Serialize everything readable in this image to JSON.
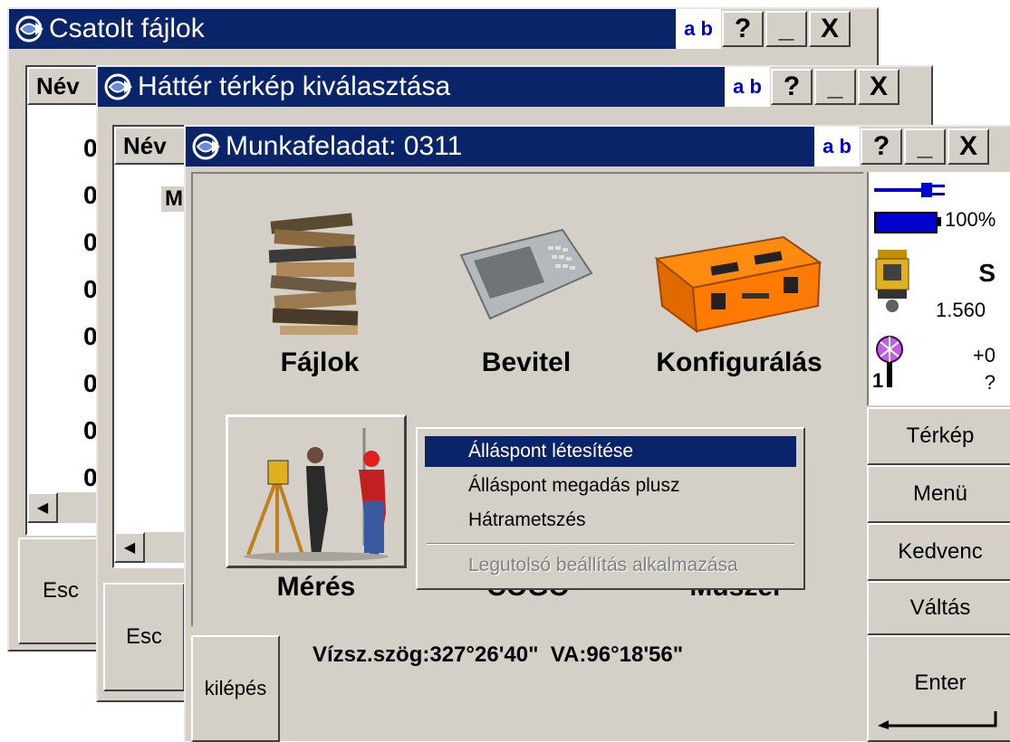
{
  "windows": {
    "csatolt": {
      "title": "Csatolt fájlok",
      "ab": "a b",
      "col_header": "Név",
      "rows": [
        "0",
        "0",
        "0",
        "0",
        "0",
        "0",
        "0",
        "0"
      ],
      "esc": "Esc"
    },
    "hatter": {
      "title": "Háttér térkép kiválasztása",
      "ab": "a b",
      "col_header": "Név",
      "first_row": "M",
      "esc": "Esc"
    },
    "munka": {
      "title": "Munkafeladat: 0311",
      "ab": "a b",
      "apps": {
        "fajlok": "Fájlok",
        "bevitel": "Bevitel",
        "konfig": "Konfigurálás",
        "meres": "Mérés",
        "cogo": "COGO",
        "muszer": "Műszer"
      },
      "status_line": "Vízsz.szög:327°26'40\"  VA:96°18'56\"",
      "kilepes": "kilépés",
      "enter": "Enter"
    }
  },
  "title_buttons": {
    "help": "?",
    "minimize": "_",
    "close": "X"
  },
  "side_status": {
    "battery_pct": "100%",
    "instrument_code": "S",
    "height": "1.560",
    "prism_offset": "+0",
    "prism_unknown": "?",
    "prism_number": "1"
  },
  "side_buttons": [
    "Térkép",
    "Menü",
    "Kedvenc",
    "Váltás"
  ],
  "context_menu": {
    "items": [
      "Álláspont létesítése",
      "Álláspont megadás plusz",
      "Hátrametszés"
    ],
    "disabled_item": "Legutolsó beállítás alkalmazása"
  },
  "colors": {
    "title_blue": "#0a246a",
    "face": "#d4d0c8",
    "ab_blue": "#0000d0"
  }
}
